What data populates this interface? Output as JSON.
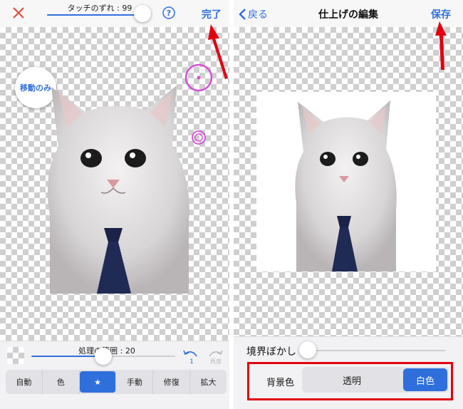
{
  "left": {
    "touch_offset_label": "タッチのずれ : 99",
    "done_label": "完了",
    "move_only_label": "移動のみ",
    "process_range_label": "処理の範囲 : 20",
    "undo_count": "1",
    "redo_label": "再度",
    "tools": [
      {
        "label": "自動",
        "active": false
      },
      {
        "label": "色",
        "active": false
      },
      {
        "label": "★",
        "active": true
      },
      {
        "label": "手動",
        "active": false
      },
      {
        "label": "修復",
        "active": false
      },
      {
        "label": "拡大",
        "active": false
      }
    ]
  },
  "right": {
    "back_label": "戻る",
    "title": "仕上げの編集",
    "save_label": "保存",
    "edge_blur_label": "境界ぼかし",
    "background_color_label": "背景色",
    "bg_options": [
      {
        "label": "透明",
        "active": false
      },
      {
        "label": "白色",
        "active": true
      }
    ]
  },
  "colors": {
    "accent": "#2f6fdc",
    "annotation_red": "#e3000f",
    "brush_ring": "#d64fd8",
    "close_red": "#e34a3c"
  }
}
